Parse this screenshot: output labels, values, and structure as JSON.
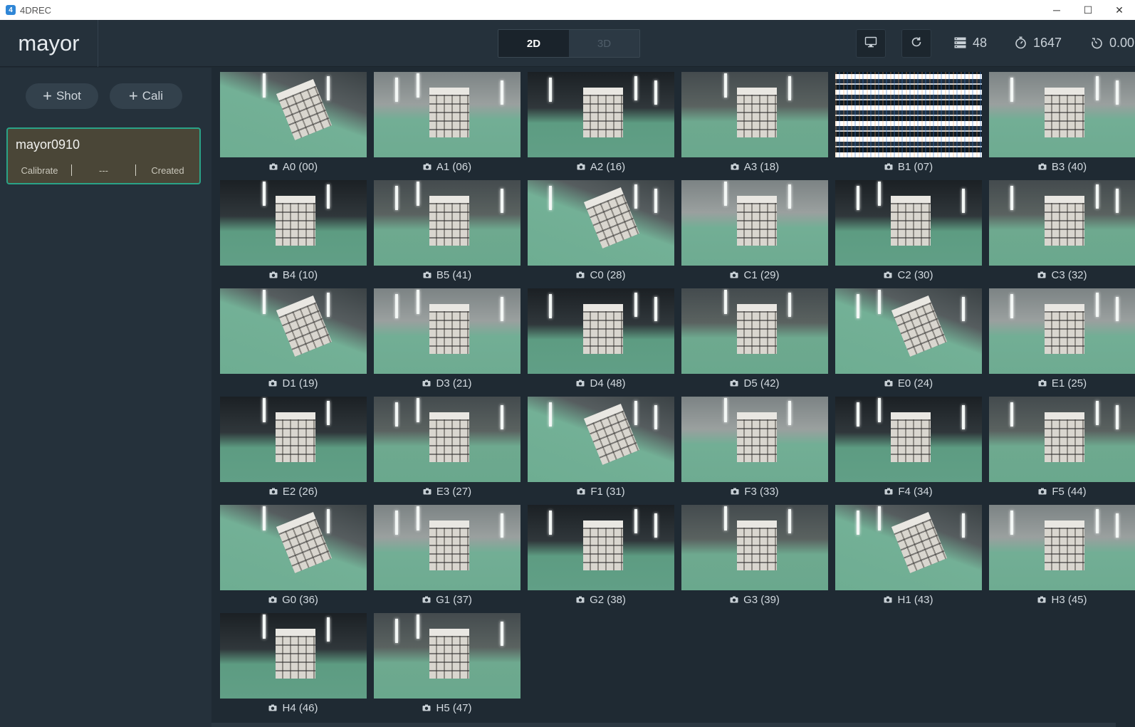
{
  "window": {
    "app_icon_text": "4",
    "title": "4DREC",
    "minimize": "─",
    "maximize": "☐",
    "close": "✕"
  },
  "header": {
    "brand": "mayor",
    "mode_2d": "2D",
    "mode_3d": "3D",
    "stats": {
      "storage": "48",
      "frames": "1647",
      "timer": "0.00"
    }
  },
  "sidebar": {
    "shot_label": "Shot",
    "cali_label": "Cali",
    "card": {
      "title": "mayor0910",
      "kind": "Calibrate",
      "middle": "---",
      "status": "Created"
    }
  },
  "cameras": [
    {
      "label": "A0 (00)"
    },
    {
      "label": "A1 (06)"
    },
    {
      "label": "A2 (16)"
    },
    {
      "label": "A3 (18)"
    },
    {
      "label": "B1 (07)"
    },
    {
      "label": "B3 (40)"
    },
    {
      "label": "B4 (10)"
    },
    {
      "label": "B5 (41)"
    },
    {
      "label": "C0 (28)"
    },
    {
      "label": "C1 (29)"
    },
    {
      "label": "C2 (30)"
    },
    {
      "label": "C3 (32)"
    },
    {
      "label": "D1 (19)"
    },
    {
      "label": "D3 (21)"
    },
    {
      "label": "D4 (48)"
    },
    {
      "label": "D5 (42)"
    },
    {
      "label": "E0 (24)"
    },
    {
      "label": "E1 (25)"
    },
    {
      "label": "E2 (26)"
    },
    {
      "label": "E3 (27)"
    },
    {
      "label": "F1 (31)"
    },
    {
      "label": "F3 (33)"
    },
    {
      "label": "F4 (34)"
    },
    {
      "label": "F5 (44)"
    },
    {
      "label": "G0 (36)"
    },
    {
      "label": "G1 (37)"
    },
    {
      "label": "G2 (38)"
    },
    {
      "label": "G3 (39)"
    },
    {
      "label": "H1 (43)"
    },
    {
      "label": "H3 (45)"
    },
    {
      "label": "H4 (46)"
    },
    {
      "label": "H5 (47)"
    }
  ],
  "colors": {
    "accent_border": "#2aa387",
    "card_bg": "#4a4637",
    "panel": "#25313b",
    "background": "#1f2a33"
  }
}
